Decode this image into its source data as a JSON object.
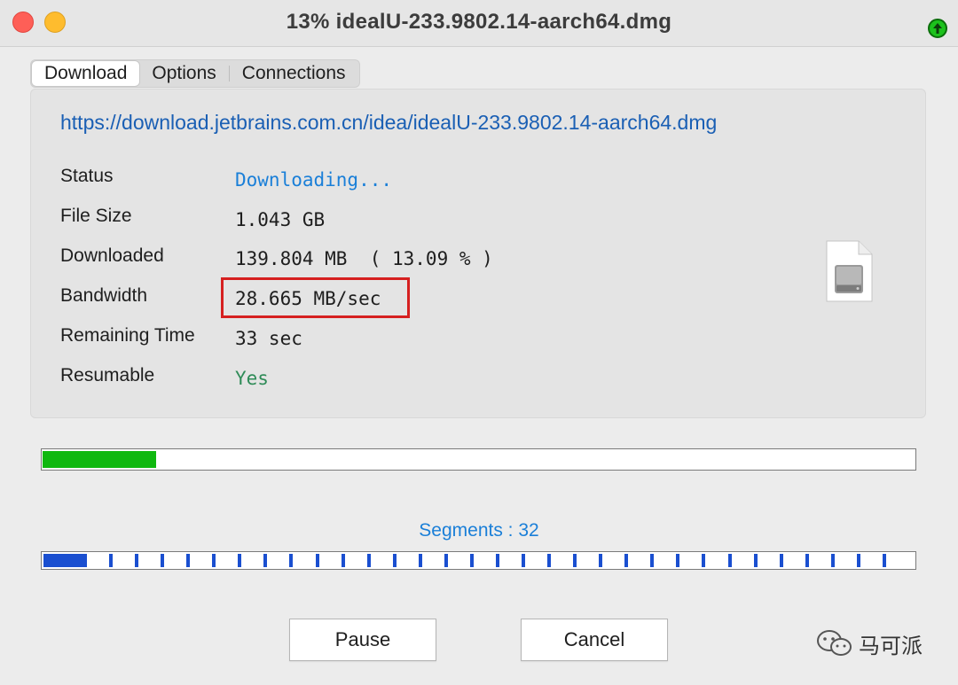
{
  "window": {
    "title": "13%  idealU-233.9802.14-aarch64.dmg"
  },
  "tabs": [
    {
      "label": "Download",
      "active": true
    },
    {
      "label": "Options",
      "active": false
    },
    {
      "label": "Connections",
      "active": false
    }
  ],
  "download": {
    "url": "https://download.jetbrains.com.cn/idea/idealU-233.9802.14-aarch64.dmg",
    "rows": [
      {
        "label": "Status",
        "value": "Downloading..."
      },
      {
        "label": "File Size",
        "value": "1.043 GB"
      },
      {
        "label": "Downloaded",
        "value": "139.804 MB  ( 13.09 % )"
      },
      {
        "label": "Bandwidth",
        "value": "28.665 MB/sec"
      },
      {
        "label": "Remaining Time",
        "value": "33 sec"
      },
      {
        "label": "Resumable",
        "value": "Yes"
      }
    ]
  },
  "progress": {
    "fraction": 0.13,
    "color": "#0fb80f"
  },
  "segments": {
    "label": "Segments : 32",
    "count": 32,
    "color": "#1a4fd0"
  },
  "buttons": {
    "pause": "Pause",
    "cancel": "Cancel"
  },
  "watermark": {
    "text": "马可派"
  },
  "icons": {
    "file": "disk-image-file-icon",
    "status": "upload-arrow-icon"
  }
}
